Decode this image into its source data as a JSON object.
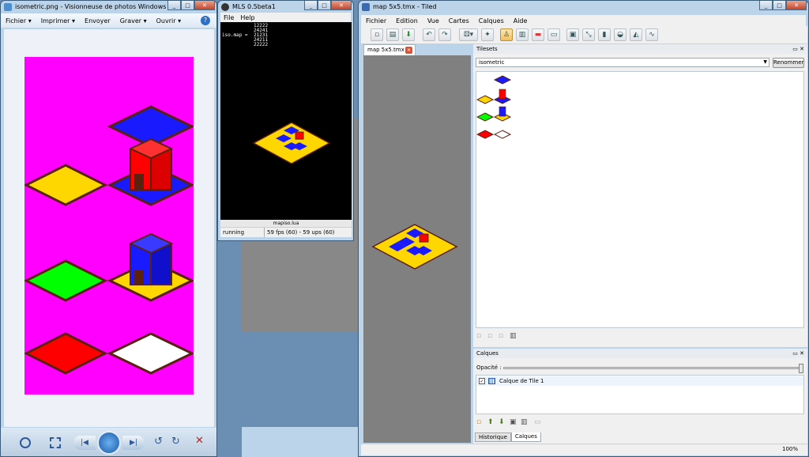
{
  "photo_viewer": {
    "title": "isometric.png - Visionneuse de photos Windows",
    "menu": [
      "Fichier ▾",
      "Imprimer ▾",
      "Envoyer",
      "Graver ▾",
      "Ouvrir ▾"
    ],
    "help_icon": "help-icon",
    "bottom_controls": [
      "zoom-icon",
      "fit-icon",
      "prev-icon",
      "slideshow-icon",
      "next-icon",
      "rotate-left-icon",
      "rotate-right-icon",
      "delete-icon"
    ]
  },
  "mls": {
    "title": "MLS 0.5beta1",
    "menu": [
      "File",
      "Help"
    ],
    "console_lines": [
      "iso.map = ",
      "12222",
      "24241",
      "21231",
      "24211",
      "22222"
    ],
    "filename": "mapiso.lua",
    "status_left": "running",
    "status_right": "59 fps (60) - 59 ups (60)"
  },
  "tiled": {
    "title": "map 5x5.tmx - Tiled",
    "menu": [
      "Fichier",
      "Edition",
      "Vue",
      "Cartes",
      "Calques",
      "Aide"
    ],
    "tab_label": "map 5x5.tmx",
    "tilesets": {
      "header": "Tilesets",
      "selected": "isometric",
      "rename_button": "Renommer"
    },
    "layers": {
      "header": "Calques",
      "opacity_label": "Opacité :",
      "layer_name": "Calque de Tile 1"
    },
    "bottom_tabs": [
      "Historique",
      "Calques"
    ],
    "zoom": "100%"
  },
  "colors": {
    "magenta": "#ff00ff",
    "blue": "#1a1aff",
    "yellow": "#ffd700",
    "green": "#00ff00",
    "red": "#ff0000",
    "white": "#ffffff",
    "dark_brown": "#5a2010"
  }
}
